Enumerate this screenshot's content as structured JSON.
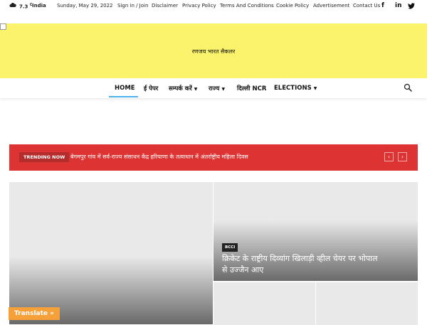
{
  "topbar": {
    "weather_icon": "cloud-icon",
    "temperature": "7.3",
    "temp_unit": "C",
    "city": "India",
    "date": "Sunday, May 29, 2022",
    "links": [
      "Sign in / Join",
      "Disclaimer",
      "Privacy Policy",
      "Terms And Conditions",
      "Cookie Policy",
      "Advertisement",
      "Contact Us"
    ],
    "social": [
      "facebook-icon",
      "linkedin-icon",
      "twitter-icon"
    ]
  },
  "banner": {
    "site_title": "रणजय भारत सैकलर",
    "background_color": "#fbf36b"
  },
  "nav": {
    "items": [
      {
        "label": "HOME"
      },
      {
        "label": "ई पेपर"
      },
      {
        "label": "सम्पर्क करें"
      },
      {
        "label": "राज्य"
      },
      {
        "label": "दिल्ली NCR"
      },
      {
        "label": "ELECTIONS"
      }
    ],
    "active_color": "#4db2ec",
    "search_icon": "search-icon"
  },
  "trending": {
    "badge": "TRENDING NOW",
    "headline": "बेगमपुर गांव में सर्व-राज्य संसाधन केंद्र हरियाणा के तत्वाधान में अंतर्राष्ट्रीय महिला दिवस",
    "prev": "‹",
    "next": "›",
    "background_color": "#dd3333"
  },
  "featured": {
    "category": "BCCI",
    "title": "क्रिकेट के राष्ट्रीय दिव्यांग खिलाड़ी व्हील चेयर पर भोपाल से उज्जैन आए"
  },
  "translate": {
    "label": "Translate »"
  }
}
